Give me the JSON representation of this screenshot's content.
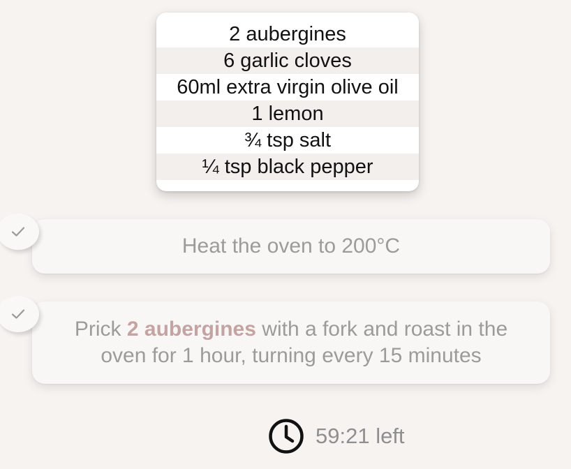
{
  "ingredients": [
    "2 aubergines",
    "6 garlic cloves",
    "60ml extra virgin olive oil",
    "1 lemon",
    "¾ tsp salt",
    "¼ tsp black pepper"
  ],
  "steps": [
    {
      "completed": true,
      "text": "Heat the oven to 200°C"
    },
    {
      "completed": true,
      "text_before": "Prick ",
      "highlight": "2 aubergines",
      "text_after": " with a fork and roast in the oven for 1 hour, turning every 15 minutes"
    }
  ],
  "timer": {
    "icon": "clock-icon",
    "text": "59:21 left"
  },
  "colors": {
    "background": "#f7f3f1",
    "highlight": "#c4a3a3",
    "muted_text": "#9b9b9b"
  }
}
